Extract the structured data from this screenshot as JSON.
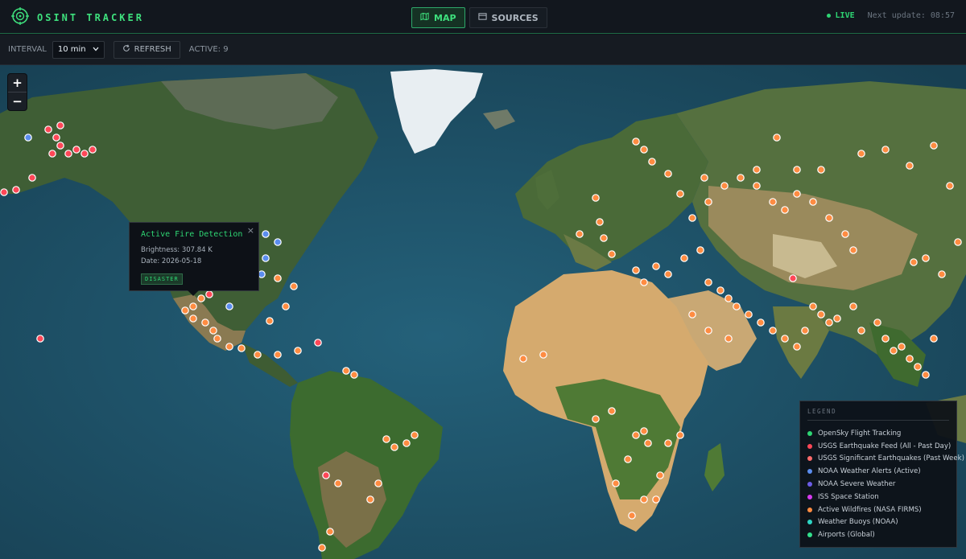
{
  "app": {
    "title": "OSINT TRACKER"
  },
  "nav": {
    "tabs": [
      {
        "label": "MAP",
        "active": true
      },
      {
        "label": "SOURCES",
        "active": false
      }
    ]
  },
  "status": {
    "live": "LIVE",
    "next_update": "Next update: 08:57"
  },
  "toolbar": {
    "interval_label": "INTERVAL",
    "interval_value": "10 min",
    "refresh_label": "REFRESH",
    "active_label": "ACTIVE: 9"
  },
  "popup": {
    "title": "Active Fire Detection",
    "brightness": "Brightness: 307.84 K",
    "date": "Date: 2026-05-18",
    "badge": "DISASTER"
  },
  "legend": {
    "title": "LEGEND",
    "items": [
      {
        "label": "OpenSky Flight Tracking",
        "color": "#2ed573"
      },
      {
        "label": "USGS Earthquake Feed (All - Past Day)",
        "color": "#ff4757"
      },
      {
        "label": "USGS Significant Earthquakes (Past Week)",
        "color": "#ff6b6b"
      },
      {
        "label": "NOAA Weather Alerts (Active)",
        "color": "#5b8def"
      },
      {
        "label": "NOAA Severe Weather",
        "color": "#6c5ce7"
      },
      {
        "label": "ISS Space Station",
        "color": "#d63af0"
      },
      {
        "label": "Active Wildfires (NASA FIRMS)",
        "color": "#ff8c42"
      },
      {
        "label": "Weather Buoys (NOAA)",
        "color": "#2ed5c4"
      },
      {
        "label": "Airports (Global)",
        "color": "#33e08c"
      }
    ]
  },
  "colors": {
    "accent": "#2ed573",
    "earthquake": "#ff4757",
    "fire": "#ff8c42",
    "weather": "#5b8def"
  },
  "icons": {
    "logo": "crosshair-icon",
    "map": "map-icon",
    "sources": "window-icon",
    "refresh": "refresh-icon",
    "chevron": "chevron-down-icon",
    "close": "close-icon",
    "zoom_in": "plus-icon",
    "zoom_out": "minus-icon"
  },
  "map_controls": {
    "zoom_in": "+",
    "zoom_out": "−",
    "close": "×"
  }
}
